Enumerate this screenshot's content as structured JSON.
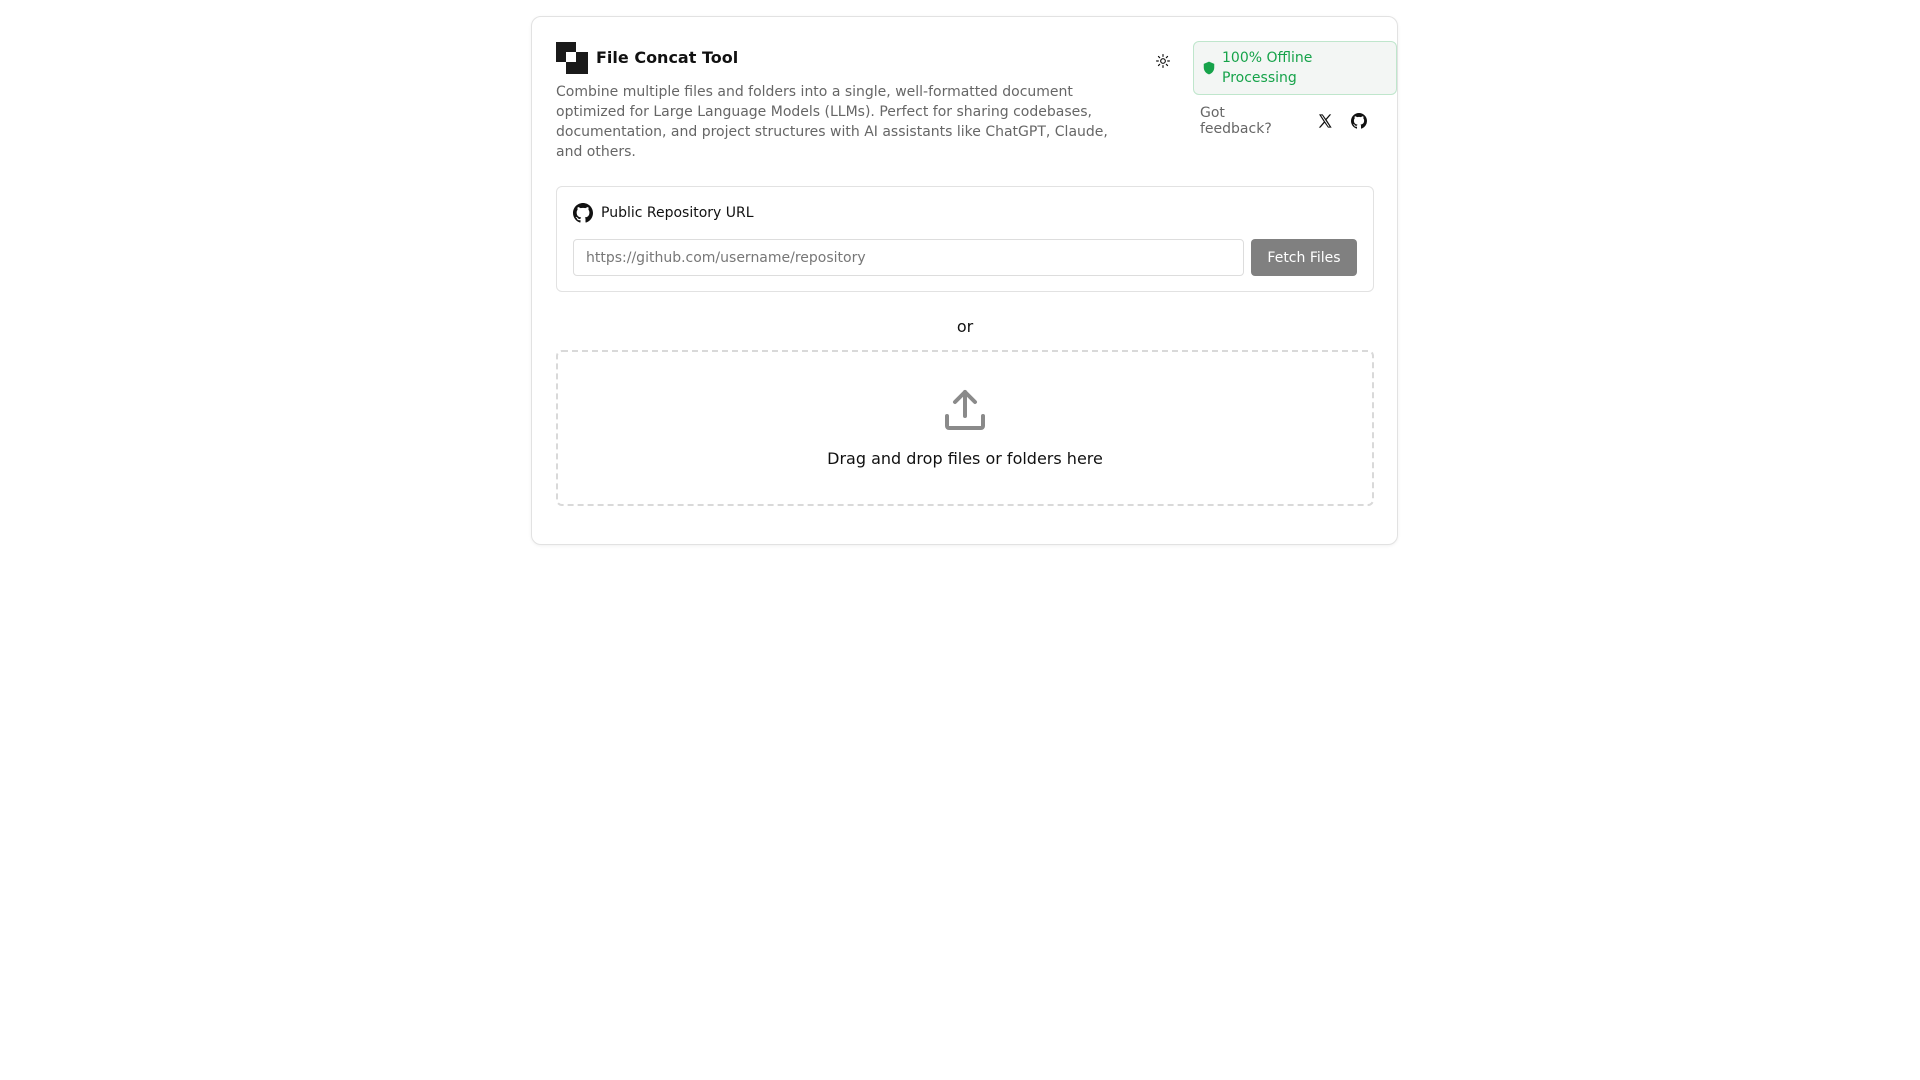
{
  "header": {
    "title": "File Concat Tool",
    "description": "Combine multiple files and folders into a single, well-formatted document optimized for Large Language Models (LLMs). Perfect for sharing codebases, documentation, and project structures with AI assistants like ChatGPT, Claude, and others.",
    "theme_icon": "sun-icon",
    "offline_badge": {
      "text": "100% Offline Processing",
      "icon": "shield-icon",
      "color": "#16a34a"
    },
    "feedback": {
      "label": "Got feedback?",
      "links": [
        {
          "icon": "x-twitter-icon"
        },
        {
          "icon": "github-icon"
        }
      ]
    }
  },
  "repository": {
    "label": "Public Repository URL",
    "icon": "github-icon",
    "input_value": "",
    "input_placeholder": "https://github.com/username/repository",
    "fetch_label": "Fetch Files"
  },
  "divider": "or",
  "dropzone": {
    "icon": "upload-icon",
    "text": "Drag and drop files or folders here"
  }
}
